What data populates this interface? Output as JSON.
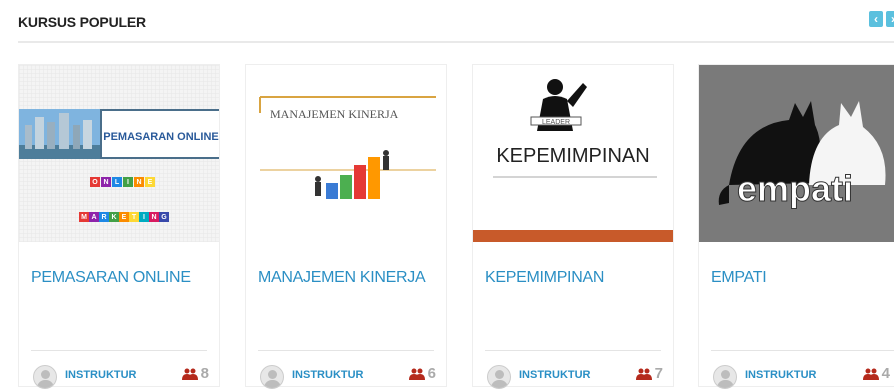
{
  "section": {
    "title": "KURSUS POPULER",
    "prev_glyph": "‹",
    "next_glyph": "›"
  },
  "courses": [
    {
      "title": "PEMASARAN ONLINE",
      "image_caption": "PEMASARAN ONLINE",
      "image_letters_top": [
        "O",
        "N",
        "L",
        "I",
        "N",
        "E"
      ],
      "image_letters_bottom": [
        "M",
        "A",
        "R",
        "K",
        "E",
        "T",
        "I",
        "N",
        "G"
      ],
      "instructor_label": "INSTRUKTUR",
      "student_count": "8"
    },
    {
      "title": "MANAJEMEN KINERJA",
      "image_caption": "MANAJEMEN KINERJA",
      "instructor_label": "INSTRUKTUR",
      "student_count": "6"
    },
    {
      "title": "KEPEMIMPINAN",
      "image_caption": "KEPEMIMPINAN",
      "image_small": "LEADER",
      "instructor_label": "INSTRUKTUR",
      "student_count": "7"
    },
    {
      "title": "EMPATI",
      "image_caption": "empati",
      "instructor_label": "INSTRUKTUR",
      "student_count": "4"
    }
  ],
  "colors": {
    "accent": "#2b8fc4",
    "nav": "#5bc0de",
    "count": "#aaaaaa",
    "users_icon": "#b52a1c"
  }
}
